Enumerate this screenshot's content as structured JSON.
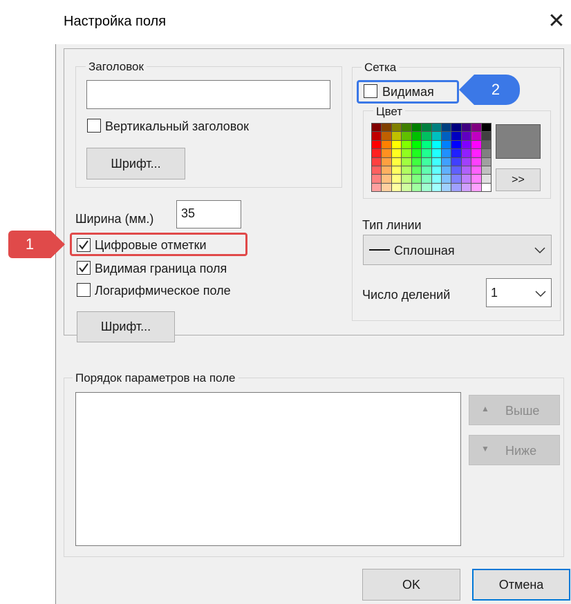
{
  "window": {
    "title": "Настройка поля",
    "close_glyph": "✕"
  },
  "header_group": {
    "legend": "Заголовок",
    "title_value": "",
    "vertical_label": "Вертикальный заголовок",
    "vertical_checked": false,
    "font_button": "Шрифт..."
  },
  "width": {
    "label": "Ширина (мм.)",
    "value": "35"
  },
  "checks": [
    {
      "label": "Цифровые отметки",
      "checked": true
    },
    {
      "label": "Видимая граница поля",
      "checked": true
    },
    {
      "label": "Логарифмическое поле",
      "checked": false
    }
  ],
  "font_button2": "Шрифт...",
  "grid_group": {
    "legend": "Сетка",
    "visible_label": "Видимая",
    "visible_checked": false,
    "color_legend": "Цвет",
    "selected_color": "#808080",
    "more_button": ">>",
    "line_type_label": "Тип линии",
    "line_type_value": "Сплошная",
    "divisions_label": "Число делений",
    "divisions_value": "1"
  },
  "order_group": {
    "legend": "Порядок параметров на поле",
    "up_button": "Выше",
    "down_button": "Ниже"
  },
  "footer": {
    "ok": "OK",
    "cancel": "Отмена"
  },
  "annotations": {
    "marker1": "1",
    "marker2": "2"
  },
  "palette_colors": [
    [
      "#800000",
      "#804000",
      "#808000",
      "#408000",
      "#008000",
      "#008040",
      "#008080",
      "#004080",
      "#000080",
      "#400080",
      "#800080",
      "#000000"
    ],
    [
      "#c00000",
      "#c06000",
      "#c0c000",
      "#60c000",
      "#00c000",
      "#00c060",
      "#00c0c0",
      "#0060c0",
      "#0000c0",
      "#6000c0",
      "#c000c0",
      "#404040"
    ],
    [
      "#ff0000",
      "#ff8000",
      "#ffff00",
      "#80ff00",
      "#00ff00",
      "#00ff80",
      "#00ffff",
      "#0080ff",
      "#0000ff",
      "#8000ff",
      "#ff00ff",
      "#606060"
    ],
    [
      "#ff2020",
      "#ff9020",
      "#ffff20",
      "#90ff20",
      "#20ff20",
      "#20ff90",
      "#20ffff",
      "#2090ff",
      "#2020ff",
      "#9020ff",
      "#ff20ff",
      "#808080"
    ],
    [
      "#ff4040",
      "#ffa040",
      "#ffff40",
      "#a0ff40",
      "#40ff40",
      "#40ffa0",
      "#40ffff",
      "#40a0ff",
      "#4040ff",
      "#a040ff",
      "#ff40ff",
      "#a0a0a0"
    ],
    [
      "#ff6060",
      "#ffb060",
      "#ffff60",
      "#b0ff60",
      "#60ff60",
      "#60ffb0",
      "#60ffff",
      "#60b0ff",
      "#6060ff",
      "#b060ff",
      "#ff60ff",
      "#c0c0c0"
    ],
    [
      "#ff8080",
      "#ffc080",
      "#ffff80",
      "#c0ff80",
      "#80ff80",
      "#80ffc0",
      "#80ffff",
      "#80c0ff",
      "#8080ff",
      "#c080ff",
      "#ff80ff",
      "#e0e0e0"
    ],
    [
      "#ffa0a0",
      "#ffd0a0",
      "#ffffa0",
      "#d0ffa0",
      "#a0ffa0",
      "#a0ffd0",
      "#a0ffff",
      "#a0d0ff",
      "#a0a0ff",
      "#d0a0ff",
      "#ffa0ff",
      "#ffffff"
    ]
  ]
}
